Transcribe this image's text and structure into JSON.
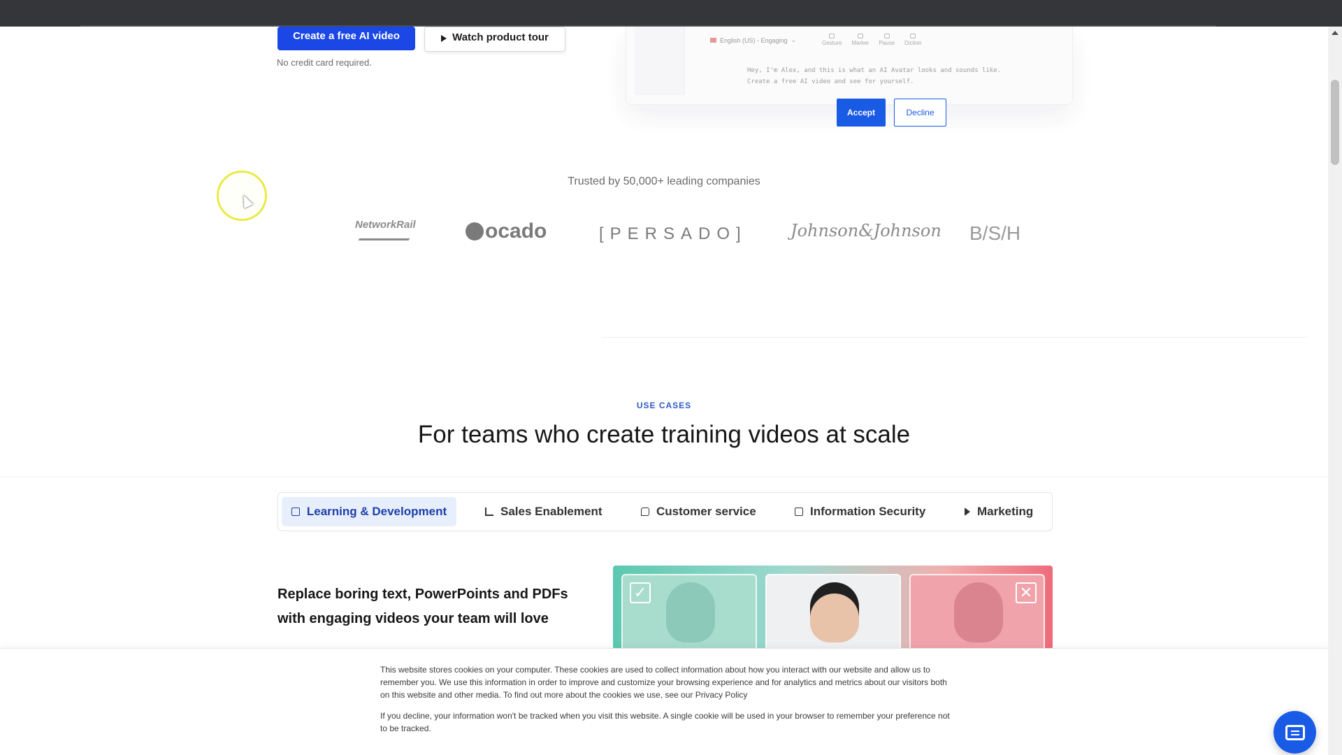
{
  "hero": {
    "primary_cta": "Create a free AI video",
    "secondary_cta": "Watch product tour",
    "note": "No credit card required."
  },
  "preview": {
    "language": "English (US) - Engaging",
    "tools": [
      "Gesture",
      "Marker",
      "Pause",
      "Diction"
    ],
    "script_line1": "Hey, I'm Alex, and this is what an AI Avatar looks and sounds like.",
    "script_line2": "Create a free AI video and see for yourself."
  },
  "trusted": {
    "label": "Trusted by 50,000+ leading companies",
    "logos": [
      "NetworkRail",
      "ocado",
      "[PERSADO]",
      "Johnson&Johnson",
      "B/S/H"
    ]
  },
  "use_cases": {
    "eyebrow": "USE CASES",
    "title": "For teams who create training videos at scale",
    "tabs": [
      {
        "label": "Learning & Development",
        "icon": "building-icon",
        "active": true
      },
      {
        "label": "Sales Enablement",
        "icon": "chart-icon",
        "active": false
      },
      {
        "label": "Customer service",
        "icon": "chat-icon",
        "active": false
      },
      {
        "label": "Information Security",
        "icon": "shield-icon",
        "active": false
      },
      {
        "label": "Marketing",
        "icon": "fast-forward-icon",
        "active": false
      }
    ],
    "feature_text": "Replace boring text, PowerPoints and PDFs with engaging videos your team will love",
    "avatar_badges": [
      "✓",
      "✕"
    ]
  },
  "cookie": {
    "text1": "This website stores cookies on your computer. These cookies are used to collect information about how you interact with our website and allow us to remember you. We use this information in order to improve and customize your browsing experience and for analytics and metrics about our visitors both on this website and other media. To find out more about the cookies we use, see our Privacy Policy",
    "text2": "If you decline, your information won't be tracked when you visit this website. A single cookie will be used in your browser to remember your preference not to be tracked.",
    "accept": "Accept",
    "decline": "Decline"
  },
  "colors": {
    "brand_blue": "#1a47e6",
    "accent_blue": "#1a5be6",
    "active_tab_bg": "#e8effc"
  }
}
